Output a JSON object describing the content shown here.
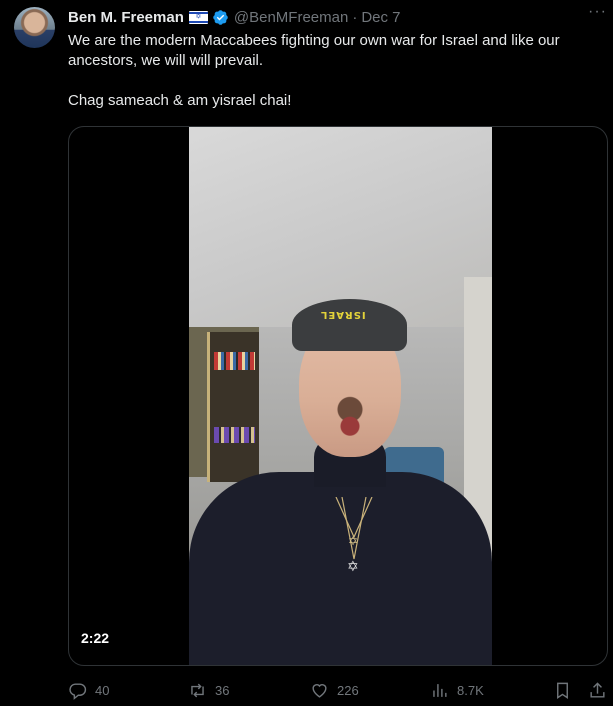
{
  "tweet": {
    "author_name": "Ben M. Freeman",
    "handle": "@BenMFreeman",
    "separator": "·",
    "date": "Dec 7",
    "text_line1": "We are the modern Maccabees fighting our own war for Israel and like our ancestors, we will will prevail.",
    "text_line2": "Chag sameach & am yisrael chai!",
    "more_label": "···"
  },
  "video": {
    "duration": "2:22"
  },
  "actions": {
    "replies": "40",
    "retweets": "36",
    "likes": "226",
    "views": "8.7K"
  },
  "icons": {
    "avatar": "profile-avatar",
    "flag": "israel-flag-icon",
    "verified": "verified-badge-icon",
    "reply": "reply-icon",
    "retweet": "retweet-icon",
    "like": "heart-icon",
    "views": "views-chart-icon",
    "bookmark": "bookmark-icon",
    "share": "share-icon"
  },
  "colors": {
    "background": "#000000",
    "text": "#e7e9ea",
    "secondary": "#71767b",
    "verified": "#1d9bf0",
    "border": "#2f3336"
  }
}
